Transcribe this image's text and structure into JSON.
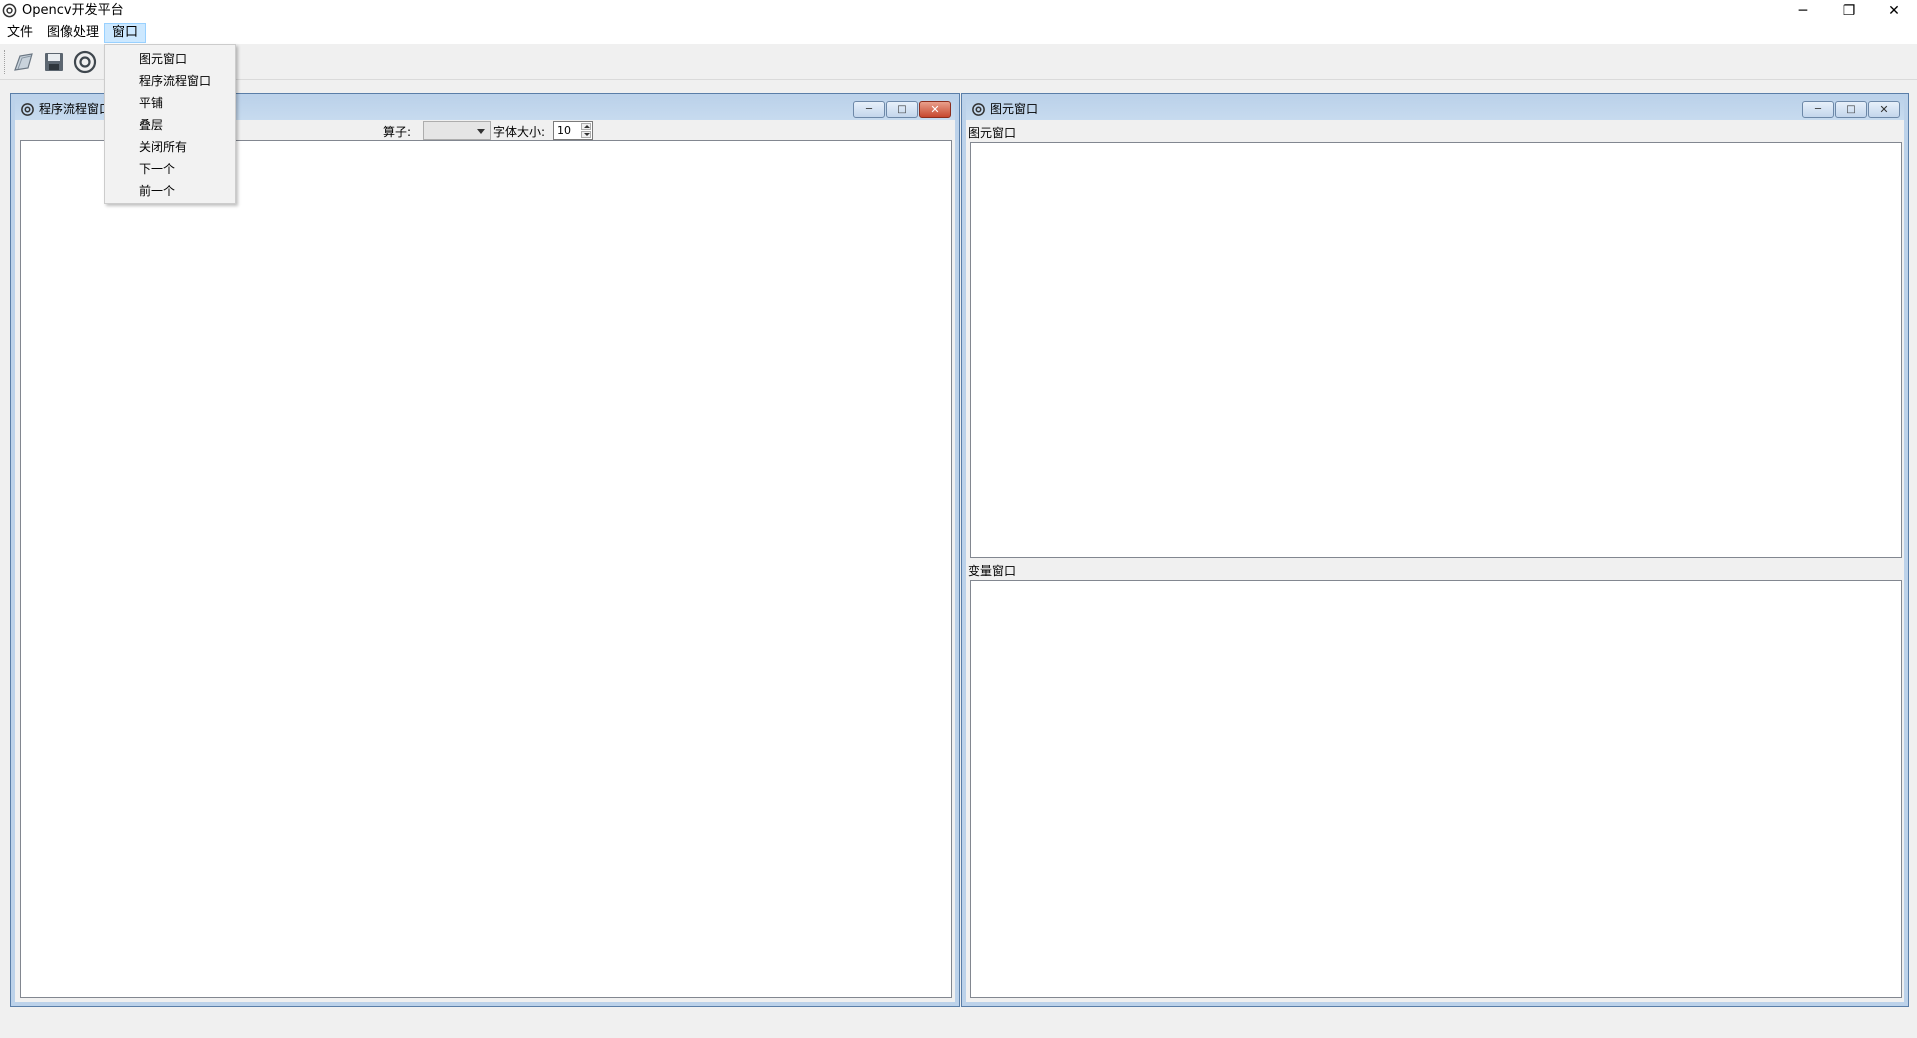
{
  "window": {
    "title": "Opencv开发平台",
    "minimize_glyph": "─",
    "restore_glyph": "❐",
    "close_glyph": "✕"
  },
  "menubar": {
    "items": [
      "文件",
      "图像处理",
      "窗口"
    ]
  },
  "window_menu": {
    "items": [
      "图元窗口",
      "程序流程窗口",
      "平铺",
      "叠层",
      "关闭所有",
      "下一个",
      "前一个"
    ]
  },
  "toolbar": {
    "icons": [
      "open-icon",
      "save-icon",
      "run-icon"
    ]
  },
  "flow_window": {
    "title": "程序流程窗口",
    "operator_label": "算子:",
    "operator_value": "",
    "fontsize_label": "字体大小:",
    "fontsize_value": "10",
    "min_glyph": "─",
    "max_glyph": "□",
    "close_glyph": "✕"
  },
  "primitive_window": {
    "title": "图元窗口",
    "primitive_label": "图元窗口",
    "variable_label": "变量窗口",
    "min_glyph": "─",
    "max_glyph": "□",
    "close_glyph": "✕"
  },
  "colors": {
    "mdi_frame": "#bcd2ea",
    "menu_highlight": "#cce8ff",
    "close_button": "#c7472e"
  }
}
